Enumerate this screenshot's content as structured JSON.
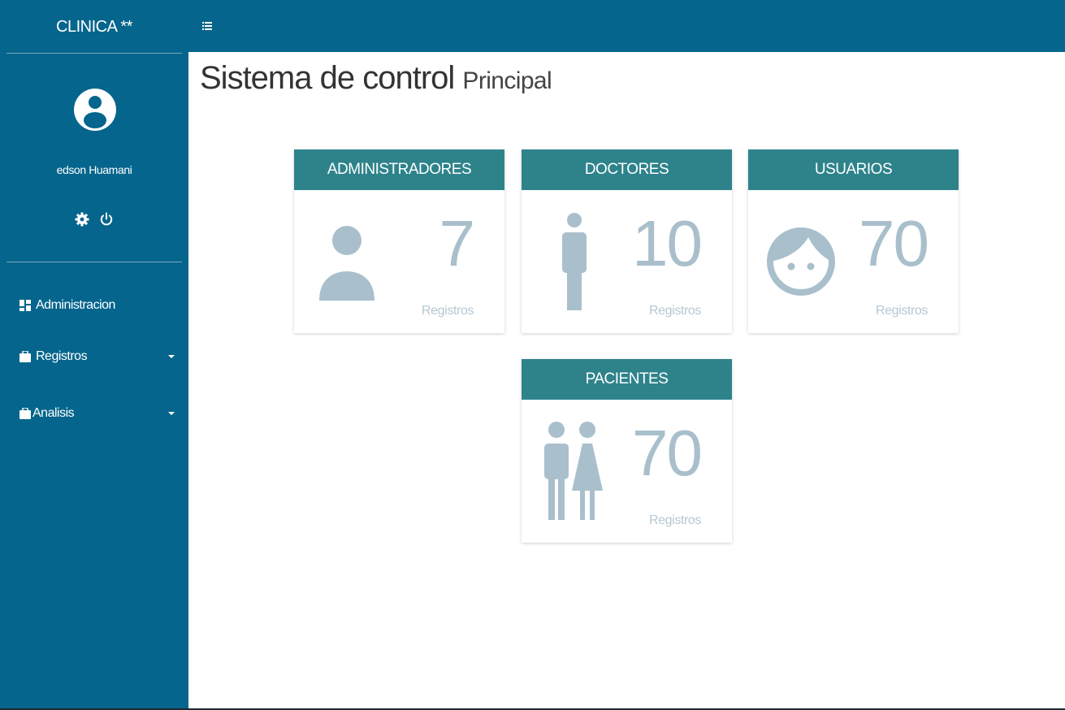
{
  "brand": {
    "title": "CLINICA **"
  },
  "user": {
    "name": "edson Huamani"
  },
  "nav": {
    "items": [
      {
        "label": "Administracion",
        "icon": "dashboard-icon"
      },
      {
        "label": "Registros",
        "icon": "briefcase-icon"
      },
      {
        "label": "Analisis",
        "icon": "briefcase-icon"
      }
    ]
  },
  "page": {
    "title": "Sistema de control",
    "subtitle": "Principal"
  },
  "cards": [
    {
      "title": "ADMINISTRADORES",
      "count": "7",
      "label": "Registros",
      "icon": "person-icon"
    },
    {
      "title": "DOCTORES",
      "count": "10",
      "label": "Registros",
      "icon": "standing-person-icon"
    },
    {
      "title": "USUARIOS",
      "count": "70",
      "label": "Registros",
      "icon": "face-icon"
    },
    {
      "title": "PACIENTES",
      "count": "70",
      "label": "Registros",
      "icon": "man-woman-icon"
    }
  ],
  "colors": {
    "sidebar": "#05658c",
    "card_header": "#2e838b",
    "card_icon": "#a9bfcc"
  }
}
